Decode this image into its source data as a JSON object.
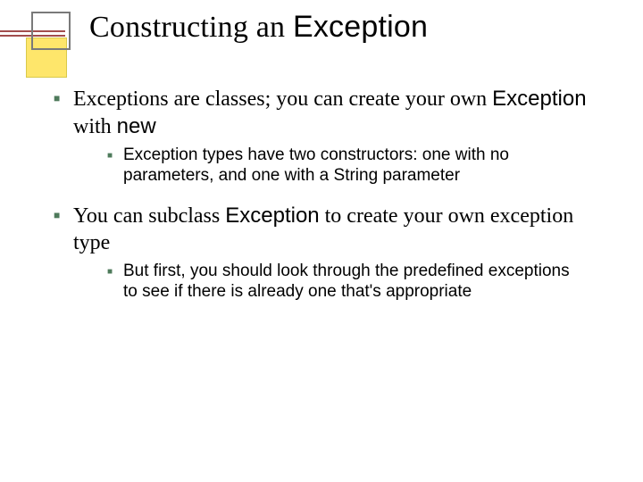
{
  "title": {
    "prefix": "Constructing an ",
    "code": "Exception"
  },
  "bullets": [
    {
      "segments": [
        {
          "t": "Exceptions are classes; you can create your own "
        },
        {
          "t": "Exception",
          "code": true
        },
        {
          "t": " with "
        },
        {
          "t": "new",
          "code": true
        }
      ],
      "sub": [
        {
          "segments": [
            {
              "t": "Exception types have two constructors: one with no parameters, and one with a "
            },
            {
              "t": "String",
              "code": true
            },
            {
              "t": " parameter"
            }
          ]
        }
      ]
    },
    {
      "segments": [
        {
          "t": "You can subclass "
        },
        {
          "t": "Exception",
          "code": true
        },
        {
          "t": " to create your own exception type"
        }
      ],
      "sub": [
        {
          "segments": [
            {
              "t": "But first, you should look through the predefined exceptions to see if there is already one that's appropriate"
            }
          ]
        }
      ]
    }
  ]
}
